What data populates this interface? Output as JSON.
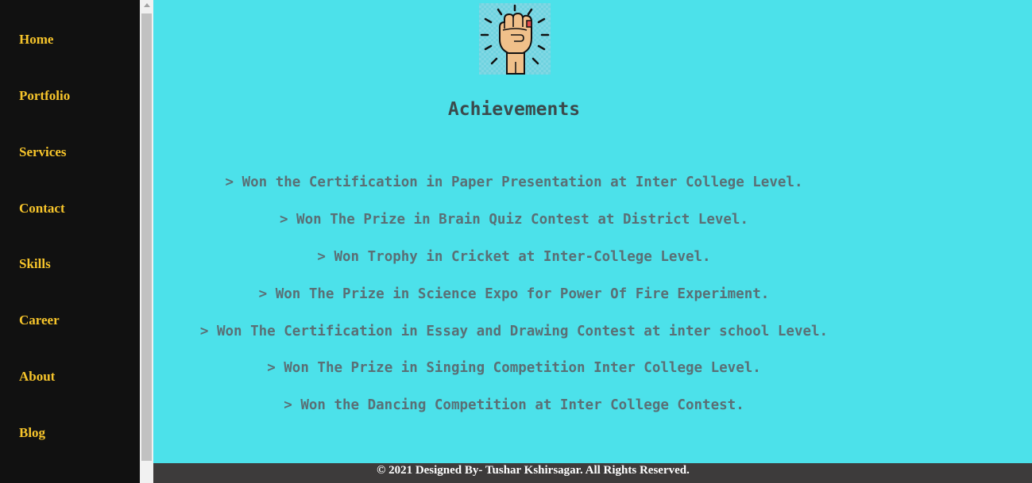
{
  "sidebar": {
    "items": [
      {
        "label": "Home"
      },
      {
        "label": "Portfolio"
      },
      {
        "label": "Services"
      },
      {
        "label": "Contact"
      },
      {
        "label": "Skills"
      },
      {
        "label": "Career"
      },
      {
        "label": "About"
      },
      {
        "label": "Blog"
      }
    ]
  },
  "main": {
    "logo_icon": "raised-fist-icon",
    "title": "Achievements",
    "achievements": [
      "> Won the Certification in Paper Presentation at Inter College Level.",
      "> Won The Prize in Brain Quiz Contest at District Level.",
      "> Won Trophy in Cricket at Inter-College Level.",
      "> Won The Prize in Science Expo for Power Of Fire Experiment.",
      "> Won The Certification in Essay and Drawing Contest at inter school Level.",
      "> Won The Prize in Singing Competition Inter College Level.",
      "> Won the Dancing Competition at Inter College Contest."
    ]
  },
  "footer": {
    "text": "© 2021 Designed By- Tushar Kshirsagar. All Rights Reserved."
  },
  "colors": {
    "background": "#4ce1ea",
    "sidebar": "#111111",
    "nav_text": "#f7c52b",
    "footer": "#3d3b3b"
  }
}
